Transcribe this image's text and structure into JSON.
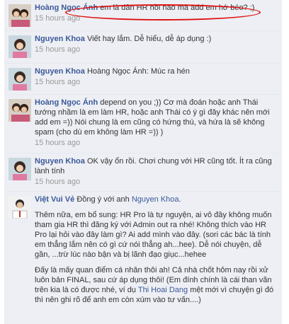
{
  "comments": [
    {
      "author": "Hoàng Ngọc Ánh",
      "text": "em là dân HR hồi nào mà add em hớ béo? ;)",
      "time": "15 hours ago",
      "avatar_icon": "avatar-two-girls-photo"
    },
    {
      "author": "Nguyen Khoa",
      "text": "Viết hay lắm. Dễ hiểu, dễ áp dụng :)",
      "time": "15 hours ago",
      "avatar_icon": "avatar-girl-photo"
    },
    {
      "author": "Nguyen Khoa",
      "text": "Hoàng Ngọc Ánh: Múc ra hén",
      "time": "15 hours ago",
      "avatar_icon": "avatar-girl-photo"
    },
    {
      "author": "Hoàng Ngọc Ánh",
      "text": "depend on you ;)) Cơ mà đoán hoặc anh Thái tướng nhầm là em làm HR, hoặc anh Thái có ý gì đây khác nên mới add em =)) Nói chung là em cũng có hứng thú, và hứa là sẽ không spam (cho dù em không làm HR =)) )",
      "time": "15 hours ago",
      "avatar_icon": "avatar-two-girls-photo"
    },
    {
      "author": "Nguyen Khoa",
      "text": "OK vậy ổn rồi. Chơi chung với HR cũng tốt. Ít ra cũng lành tính",
      "time": "15 hours ago",
      "avatar_icon": "avatar-girl-photo"
    },
    {
      "author": "Việt Vui Vẻ",
      "text_pre": "Đồng ý với anh",
      "mention": "Nguyen Khoa",
      "text_post": ".",
      "para1": "Thêm nữa, em bổ sung: HR Pro là tự nguyện, ai vô đây không muốn tham gia HR thì đăng ký với Admin out ra nhé! Không thích vào HR Pro lại hỏi vào đây làm gì? Ai add mình vào đây. (sori các bác là tính em thẳng lắm nên có gì cứ nói thẳng ah...hee). Dễ nói chuyện, dễ gần, ...trừ lúc nào bận và bị lãnh đạo giục...hehee",
      "para2_pre": "Đấy là mấy quan điểm cá nhân thôi ah! Cả nhà chốt hôm nay rồi xử luôn bản FINAL, sau cứ áp dụng thôi! (Em đính chính là cái than vãn trên kia là có được nhé, ví dụ",
      "para2_mention": "Thi Hoai Dang",
      "para2_post": "mệt mới vì chuyện gì đó thì nên ghi rõ để anh em còn xúm vào tư vấn....)",
      "avatar_icon": "avatar-man-photo"
    }
  ]
}
